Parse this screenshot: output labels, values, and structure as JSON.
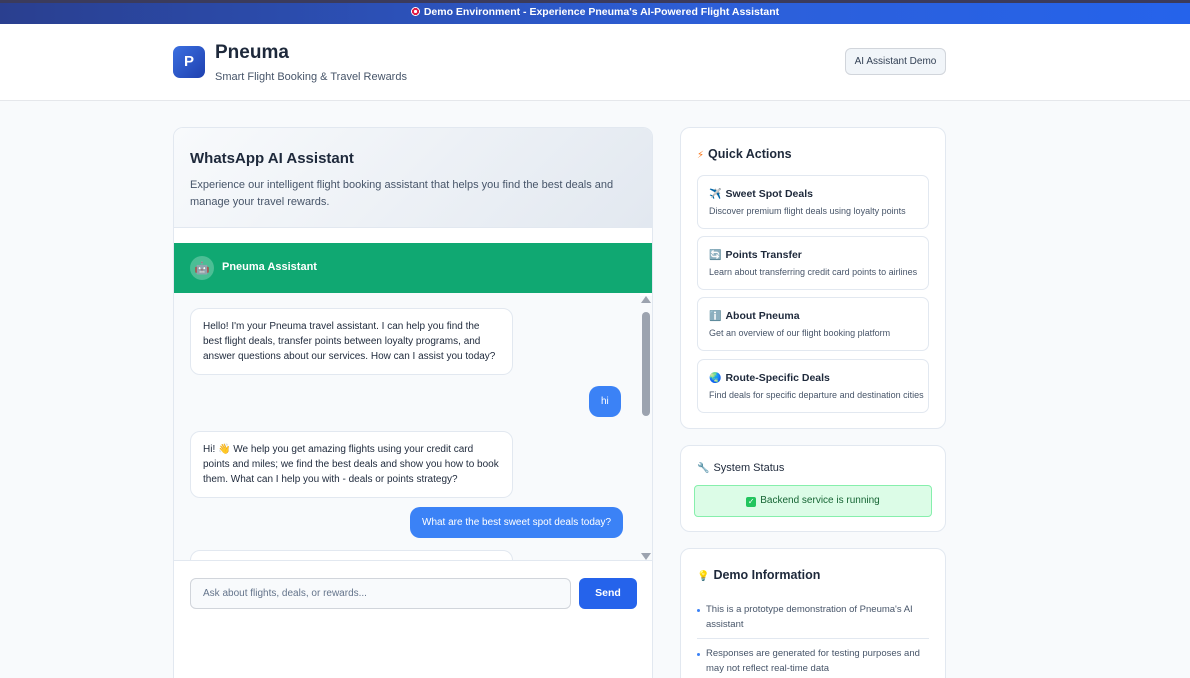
{
  "banner": {
    "text": "Demo Environment - Experience Pneuma's AI-Powered Flight Assistant"
  },
  "header": {
    "logo_letter": "P",
    "brand": "Pneuma",
    "tagline": "Smart Flight Booking & Travel Rewards",
    "demo_button": "AI Assistant Demo"
  },
  "chat": {
    "title": "WhatsApp AI Assistant",
    "description": "Experience our intelligent flight booking assistant that helps you find the best deals and manage your travel rewards.",
    "assistant_name": "Pneuma Assistant",
    "assistant_icon": "robot-icon",
    "messages": [
      {
        "role": "bot",
        "text": "Hello! I'm your Pneuma travel assistant. I can help you find the best flight deals, transfer points between loyalty programs, and answer questions about our services. How can I assist you today?"
      },
      {
        "role": "user",
        "text": "hi"
      },
      {
        "role": "bot",
        "text": "Hi! 👋 We help you get amazing flights using your credit card points and miles; we find the best deals and show you how to book them. What can I help you with - deals or points strategy?"
      },
      {
        "role": "user",
        "text": "What are the best sweet spot deals today?"
      }
    ],
    "input_placeholder": "Ask about flights, deals, or rewards...",
    "send_label": "Send",
    "accent_color": "#10a872"
  },
  "quick_actions": {
    "title": "Quick Actions",
    "icon": "lightning-icon",
    "items": [
      {
        "icon": "✈️",
        "title": "Sweet Spot Deals",
        "desc": "Discover premium flight deals using loyalty points"
      },
      {
        "icon": "🔄",
        "title": "Points Transfer",
        "desc": "Learn about transferring credit card points to airlines"
      },
      {
        "icon": "ℹ️",
        "title": "About Pneuma",
        "desc": "Get an overview of our flight booking platform"
      },
      {
        "icon": "🌏",
        "title": "Route-Specific Deals",
        "desc": "Find deals for specific departure and destination cities"
      }
    ]
  },
  "system_status": {
    "title": "System Status",
    "icon": "wrench-icon",
    "status_text": "Backend service is running",
    "status_color": "#dcfce7"
  },
  "demo_info": {
    "title": "Demo Information",
    "icon": "lightbulb-icon",
    "items": [
      "This is a prototype demonstration of Pneuma's AI assistant",
      "Responses are generated for testing purposes and may not reflect real-time data"
    ]
  }
}
